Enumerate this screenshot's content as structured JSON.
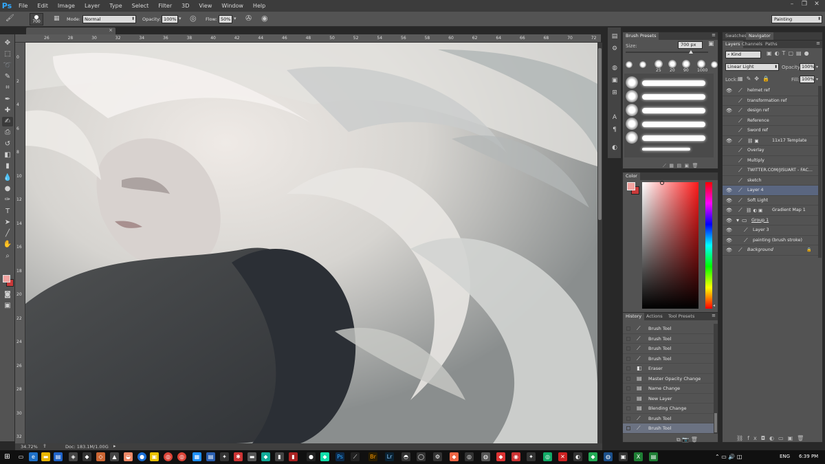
{
  "app": {
    "logo": "Ps"
  },
  "menu": [
    "File",
    "Edit",
    "Image",
    "Layer",
    "Type",
    "Select",
    "Filter",
    "3D",
    "View",
    "Window",
    "Help"
  ],
  "options": {
    "brush_size": "700",
    "mode_label": "Mode:",
    "mode_value": "Normal",
    "opacity_label": "Opacity:",
    "opacity_value": "100%",
    "flow_label": "Flow:",
    "flow_value": "50%",
    "workspace": "Painting"
  },
  "ruler_top": [
    "26",
    "28",
    "30",
    "32",
    "34",
    "36",
    "38",
    "40",
    "42",
    "44",
    "46",
    "48",
    "50",
    "52",
    "54",
    "56",
    "58",
    "60",
    "62",
    "64",
    "66",
    "68",
    "70",
    "72"
  ],
  "ruler_left": [
    "0",
    "2",
    "4",
    "6",
    "8",
    "10",
    "12",
    "14",
    "16",
    "18",
    "20",
    "22",
    "24",
    "26",
    "28",
    "30",
    "32"
  ],
  "status": {
    "zoom": "34.72%",
    "doc": "Doc: 183.1M/1.00G"
  },
  "brush_presets": {
    "tab": "Brush Presets",
    "size_label": "Size:",
    "size_value": "700 px",
    "preset_numbers": [
      "25",
      "20",
      "90",
      "1000"
    ]
  },
  "color_panel": {
    "tab": "Color",
    "foreground": "#f2a3a0",
    "background": "#c93a3a"
  },
  "history": {
    "tabs": [
      "History",
      "Actions",
      "Tool Presets"
    ],
    "items": [
      {
        "label": "Brush Tool",
        "icon": "brush-icon"
      },
      {
        "label": "Brush Tool",
        "icon": "brush-icon"
      },
      {
        "label": "Brush Tool",
        "icon": "brush-icon"
      },
      {
        "label": "Brush Tool",
        "icon": "brush-icon"
      },
      {
        "label": "Eraser",
        "icon": "eraser-icon"
      },
      {
        "label": "Master Opacity Change",
        "icon": "document-icon"
      },
      {
        "label": "Name Change",
        "icon": "document-icon"
      },
      {
        "label": "New Layer",
        "icon": "document-icon"
      },
      {
        "label": "Blending Change",
        "icon": "document-icon"
      },
      {
        "label": "Brush Tool",
        "icon": "brush-icon"
      },
      {
        "label": "Brush Tool",
        "icon": "brush-icon"
      },
      {
        "label": "Brush Tool",
        "icon": "brush-icon"
      }
    ]
  },
  "navigator": {
    "tabs": [
      "Swatches",
      "Navigator"
    ]
  },
  "layers": {
    "tabs": [
      "Layers",
      "Channels",
      "Paths"
    ],
    "filter": "Kind",
    "blend_mode": "Linear Light",
    "opacity_label": "Opacity:",
    "opacity_value": "100%",
    "lock_label": "Lock:",
    "fill_label": "Fill:",
    "fill_value": "100%",
    "items": [
      {
        "name": "helmet ref",
        "visible": true,
        "indent": 0
      },
      {
        "name": "transformation ref",
        "visible": false,
        "indent": 0
      },
      {
        "name": "design ref",
        "visible": true,
        "indent": 0
      },
      {
        "name": "Reference",
        "visible": false,
        "indent": 0
      },
      {
        "name": "Sword ref",
        "visible": false,
        "indent": 0
      },
      {
        "name": "11x17 Template",
        "visible": true,
        "indent": 0
      },
      {
        "name": "Overlay",
        "visible": false,
        "indent": 0
      },
      {
        "name": "Multiply",
        "visible": false,
        "indent": 0
      },
      {
        "name": "TWITTER.COM/JISUART - FAC...",
        "visible": false,
        "indent": 0
      },
      {
        "name": "sketch",
        "visible": false,
        "indent": 0
      },
      {
        "name": "Layer 4",
        "visible": true,
        "indent": 0,
        "selected": true
      },
      {
        "name": "Soft Light",
        "visible": true,
        "indent": 0
      },
      {
        "name": "Gradient Map 1",
        "visible": true,
        "indent": 0
      },
      {
        "name": "Group 1",
        "visible": true,
        "indent": 0,
        "group": true
      },
      {
        "name": "Layer 3",
        "visible": true,
        "indent": 1
      },
      {
        "name": "painting (brush stroke)",
        "visible": true,
        "indent": 1
      },
      {
        "name": "Background",
        "visible": true,
        "indent": 0,
        "locked": true
      }
    ]
  },
  "taskbar": {
    "lang": "ENG",
    "time": "6:39 PM"
  }
}
